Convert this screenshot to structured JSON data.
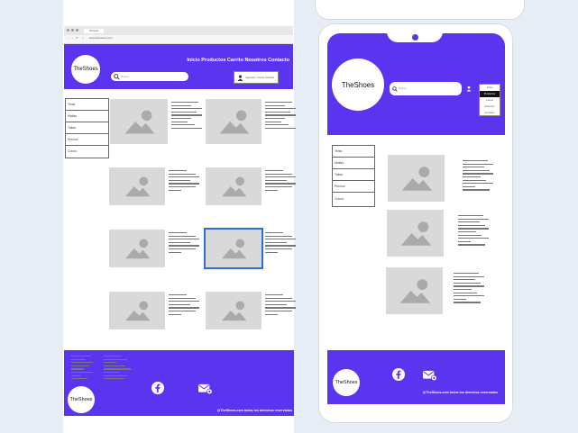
{
  "browser": {
    "tab_title": "Shoppe",
    "url": "www.theshoes.com"
  },
  "brand": {
    "logo_text": "TheShoes",
    "accent": "#5b34f0"
  },
  "nav": {
    "links": "Inicio Productos Carrito Nosotros Contacto"
  },
  "search": {
    "placeholder": "Buscar"
  },
  "login": {
    "label": "Ingresar / Crear Usuario"
  },
  "categories": [
    "Tenis",
    "Mallas",
    "Tallas",
    "Precios",
    "Colors"
  ],
  "mobile_menu": {
    "items": [
      "Inicio",
      "Productos",
      "Carrito",
      "Nosotros",
      "Contacto"
    ],
    "active": "Productos"
  },
  "footer": {
    "copyright": "@TheShoes.com todos los derechos reservados",
    "icons": [
      "facebook-icon",
      "mail-icon"
    ]
  },
  "icons": {
    "image": "image-placeholder-icon",
    "user": "user-icon",
    "search": "search-icon"
  }
}
